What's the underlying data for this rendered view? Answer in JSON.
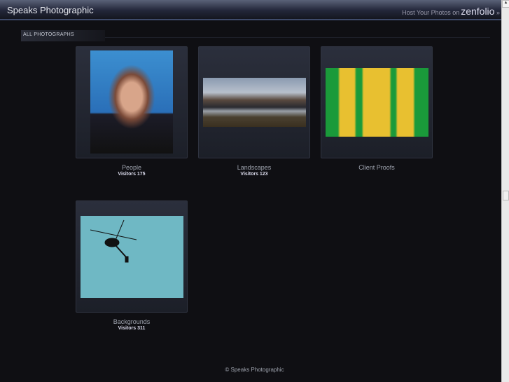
{
  "header": {
    "site_title": "Speaks Photographic",
    "host_text": "Host Your Photos on",
    "brand": "zenfolio",
    "arrow": "»"
  },
  "breadcrumb": "ALL PHOTOGRAPHS",
  "galleries": [
    {
      "title": "People",
      "visitors": "Visitors 175"
    },
    {
      "title": "Landscapes",
      "visitors": "Visitors 123"
    },
    {
      "title": "Client Proofs",
      "visitors": ""
    },
    {
      "title": "Backgrounds",
      "visitors": "Visitors 311"
    }
  ],
  "footer": "© Speaks Photographic"
}
